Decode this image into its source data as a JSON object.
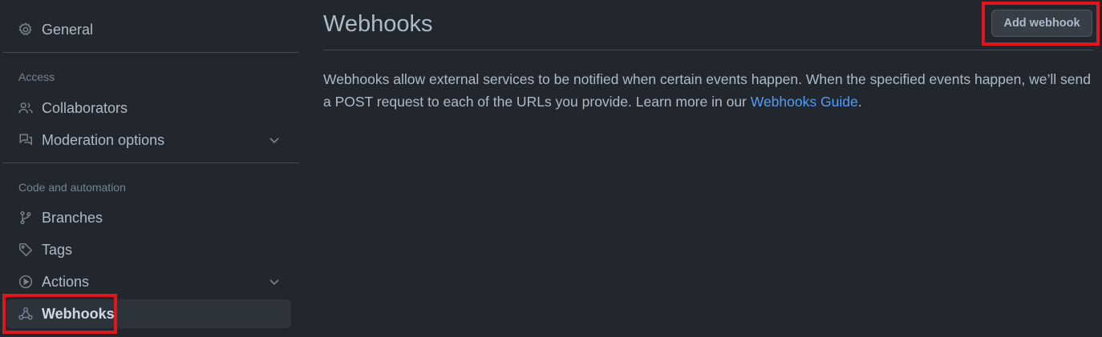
{
  "sidebar": {
    "general": {
      "label": "General",
      "icon": "gear-icon"
    },
    "sections": {
      "access": "Access",
      "code_automation": "Code and automation"
    },
    "items": {
      "collaborators": {
        "label": "Collaborators",
        "icon": "people-icon"
      },
      "moderation": {
        "label": "Moderation options",
        "icon": "comment-discussion-icon"
      },
      "branches": {
        "label": "Branches",
        "icon": "git-branch-icon"
      },
      "tags": {
        "label": "Tags",
        "icon": "tag-icon"
      },
      "actions": {
        "label": "Actions",
        "icon": "play-icon"
      },
      "webhooks": {
        "label": "Webhooks",
        "icon": "webhook-icon",
        "active": true
      }
    }
  },
  "main": {
    "title": "Webhooks",
    "add_button": "Add webhook",
    "description_text": "Webhooks allow external services to be notified when certain events happen. When the specified events happen, we’ll send a POST request to each of the URLs you provide. Learn more in our ",
    "description_link": "Webhooks Guide",
    "description_end": "."
  },
  "colors": {
    "background": "#22272e",
    "text": "#adbac7",
    "link": "#539bf5",
    "highlight": "#e0161e"
  }
}
